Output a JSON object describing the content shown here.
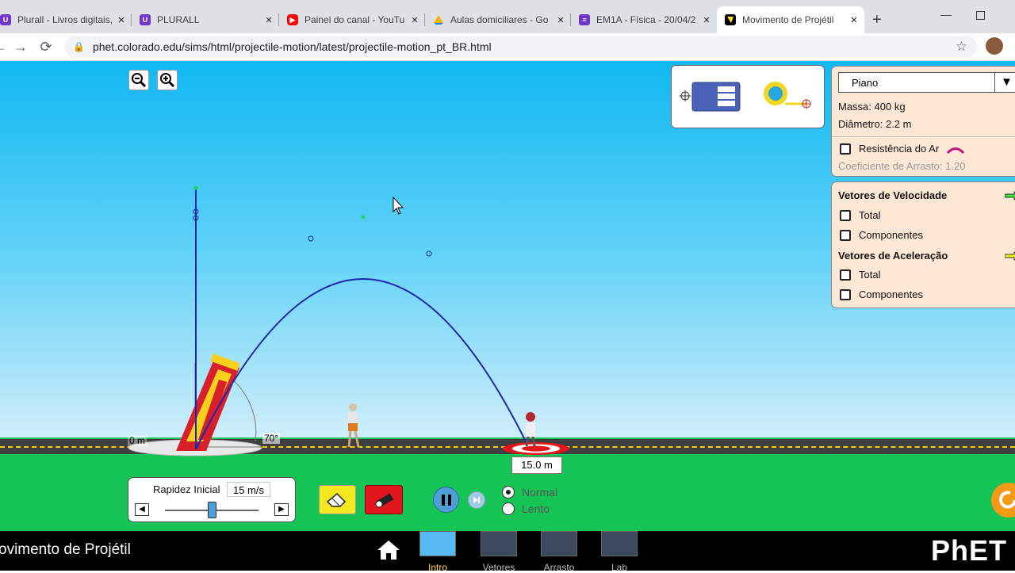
{
  "browser": {
    "tabs": [
      {
        "title": "Plurall - Livros digitais, ",
        "color": "#6e36c7"
      },
      {
        "title": "PLURALL",
        "color": "#6e36c7"
      },
      {
        "title": "Painel do canal - YouTu",
        "color": "#ff0000"
      },
      {
        "title": "Aulas domiciliares - Go",
        "color": "#f4b400"
      },
      {
        "title": "EM1A - Física - 20/04/2",
        "color": "#6e36c7"
      },
      {
        "title": "Movimento de Projétil",
        "color": "#000000"
      }
    ],
    "new_tab": "+",
    "url": "phet.colorado.edu/sims/html/projectile-motion/latest/projectile-motion_pt_BR.html",
    "close_glyph": "×"
  },
  "projectile": {
    "selected": "Piano",
    "mass": "Massa: 400 kg",
    "diameter": "Diâmetro: 2.2 m",
    "air_resistance": "Resistência do Ar",
    "drag_coefficient": "Coeficiente de Arrasto: 1.20"
  },
  "vectors": {
    "velocity_title": "Vetores de Velocidade",
    "velocity_total": "Total",
    "velocity_components": "Componentes",
    "acceleration_title": "Vetores de Aceleração",
    "acceleration_total": "Total",
    "acceleration_components": "Componentes"
  },
  "scene": {
    "origin_label": "0 m",
    "angle_label": "70°",
    "target_label": "15.0 m"
  },
  "launch": {
    "speed_label": "Rapidez Inicial",
    "speed_value": "15 m/s",
    "speed_fraction": 0.5
  },
  "playback": {
    "normal": "Normal",
    "slow": "Lento",
    "selected": "Normal"
  },
  "footer": {
    "sim_title": "ovimento de Projétil",
    "screens": [
      "Intro",
      "Vetores",
      "Arrasto",
      "Lab"
    ],
    "active_screen": "Intro",
    "brand": "PhET"
  },
  "colors": {
    "trajectory": "#1b28b0",
    "cannon": "#d8202a",
    "eraser_button": "#f5e81f",
    "fire_button": "#e0161c",
    "target": "#e0161c"
  }
}
